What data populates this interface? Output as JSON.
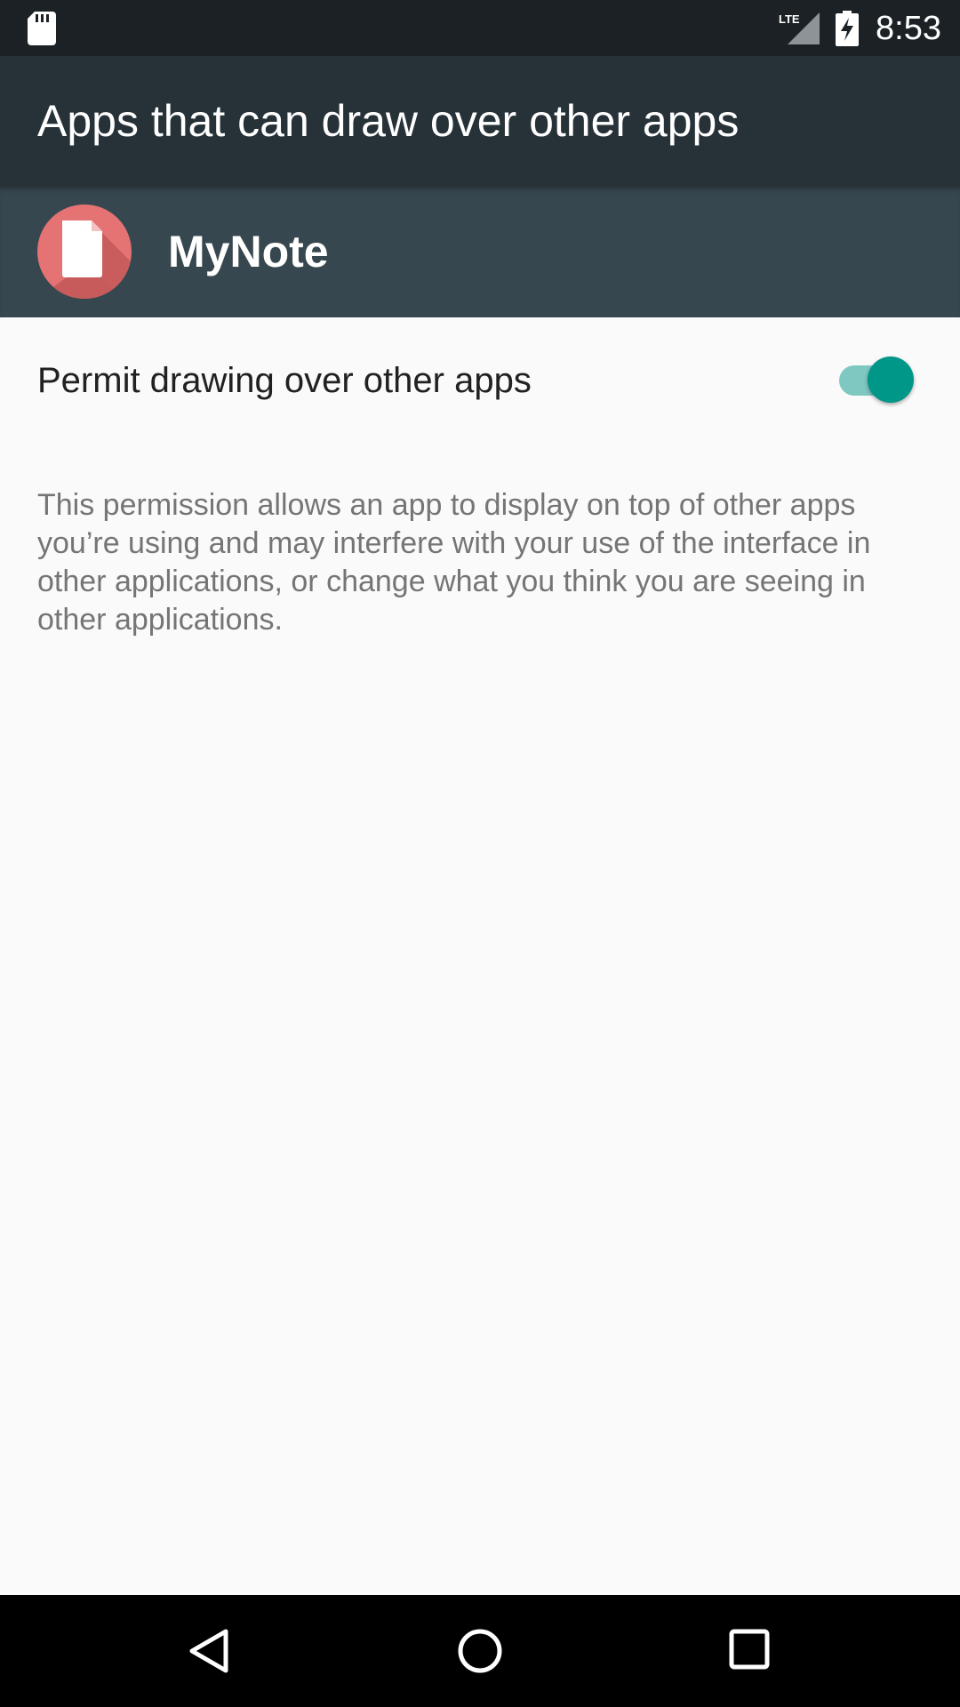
{
  "status_bar": {
    "time": "8:53",
    "network_label": "LTE",
    "icons": [
      "sd-card-icon",
      "signal-icon",
      "battery-charging-icon"
    ]
  },
  "app_bar": {
    "title": "Apps that can draw over other apps"
  },
  "app": {
    "name": "MyNote",
    "icon": "note-document-icon",
    "icon_color": "#e57373"
  },
  "permission": {
    "label": "Permit drawing over other apps",
    "enabled": true,
    "accent_color": "#009688",
    "description": "This permission allows an app to display on top of other apps you’re using and may interfere with your use of the interface in other applications, or change what you think you are seeing in other applications."
  },
  "nav_bar": {
    "buttons": [
      "back-icon",
      "home-icon",
      "recents-icon"
    ]
  }
}
